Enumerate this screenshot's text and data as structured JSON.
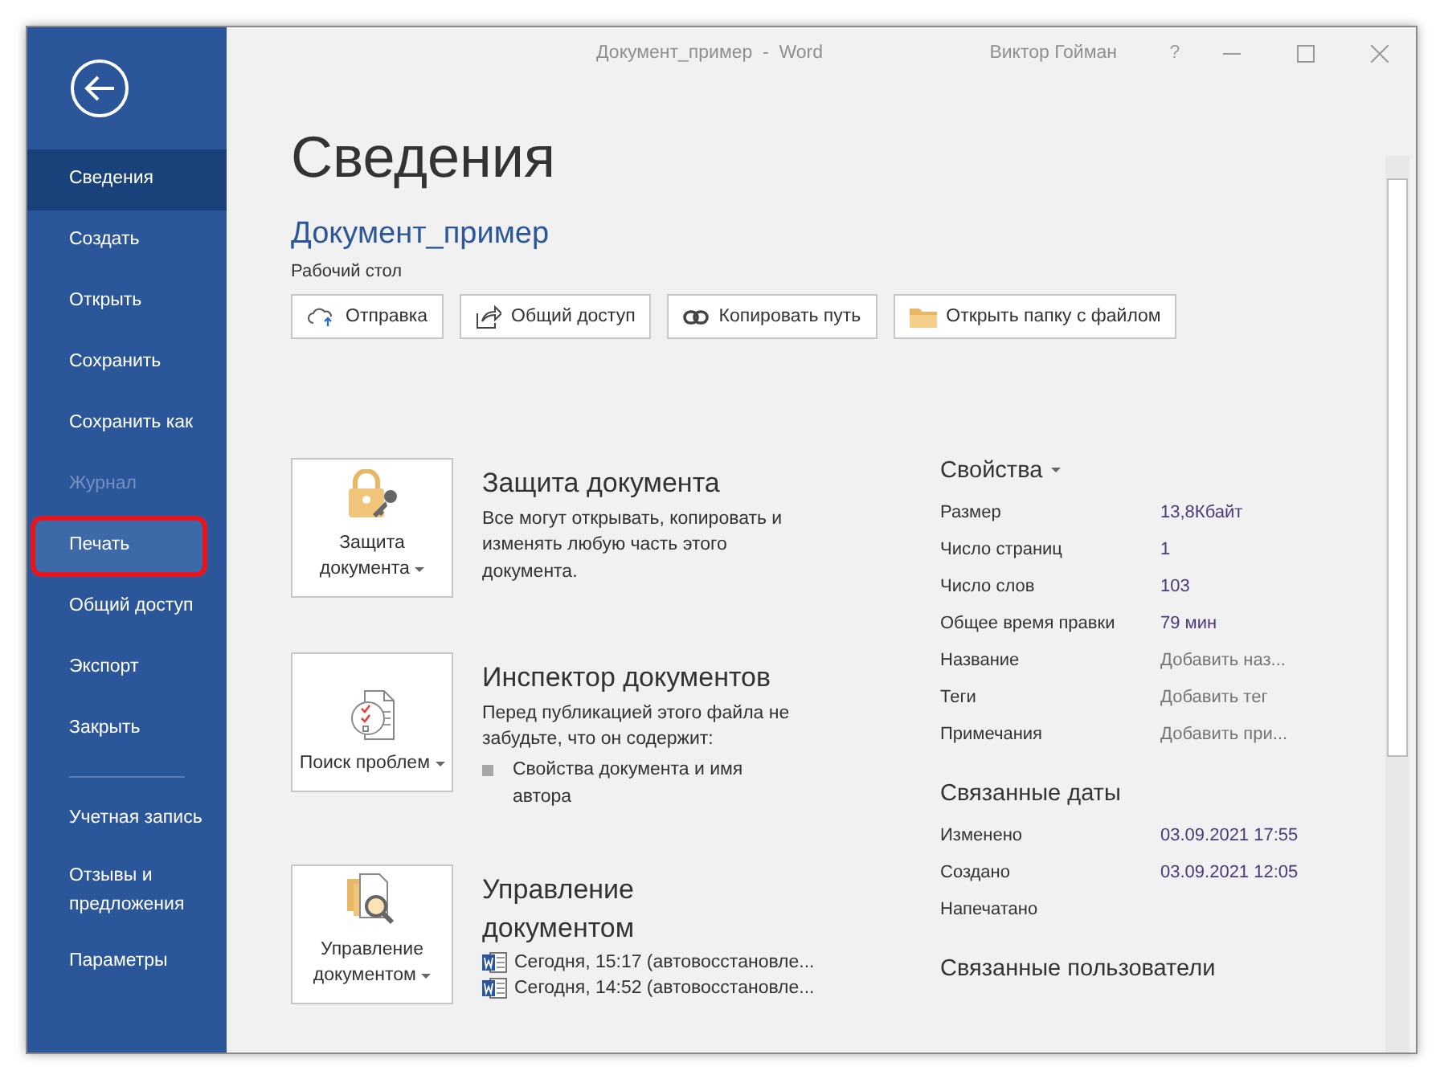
{
  "window": {
    "title": "Документ_пример  -  Word",
    "user": "Виктор Гойман",
    "help": "?"
  },
  "sidebar": {
    "items": [
      {
        "label": "Сведения",
        "selected": true,
        "disabled": false,
        "highlighted": false,
        "divider_before": false
      },
      {
        "label": "Создать",
        "selected": false,
        "disabled": false,
        "highlighted": false,
        "divider_before": false
      },
      {
        "label": "Открыть",
        "selected": false,
        "disabled": false,
        "highlighted": false,
        "divider_before": false
      },
      {
        "label": "Сохранить",
        "selected": false,
        "disabled": false,
        "highlighted": false,
        "divider_before": false
      },
      {
        "label": "Сохранить как",
        "selected": false,
        "disabled": false,
        "highlighted": false,
        "divider_before": false
      },
      {
        "label": "Журнал",
        "selected": false,
        "disabled": true,
        "highlighted": false,
        "divider_before": false
      },
      {
        "label": "Печать",
        "selected": false,
        "disabled": false,
        "highlighted": true,
        "divider_before": false
      },
      {
        "label": "Общий доступ",
        "selected": false,
        "disabled": false,
        "highlighted": false,
        "divider_before": false
      },
      {
        "label": "Экспорт",
        "selected": false,
        "disabled": false,
        "highlighted": false,
        "divider_before": false
      },
      {
        "label": "Закрыть",
        "selected": false,
        "disabled": false,
        "highlighted": false,
        "divider_before": false
      },
      {
        "label": "Учетная запись",
        "selected": false,
        "disabled": false,
        "highlighted": false,
        "divider_before": true
      },
      {
        "label": "Отзывы и предложения",
        "selected": false,
        "disabled": false,
        "highlighted": false,
        "divider_before": false
      },
      {
        "label": "Параметры",
        "selected": false,
        "disabled": false,
        "highlighted": false,
        "divider_before": false
      }
    ]
  },
  "page_title": "Сведения",
  "document": {
    "name": "Документ_пример",
    "location": "Рабочий стол"
  },
  "actions": [
    {
      "kind": "upload",
      "label": "Отправка"
    },
    {
      "kind": "share",
      "label": "Общий доступ"
    },
    {
      "kind": "link",
      "label": "Копировать путь"
    },
    {
      "kind": "folder",
      "label": "Открыть папку с файлом"
    }
  ],
  "sections": [
    {
      "kind": "protect",
      "tile": "Защита документа",
      "heading": "Защита документа",
      "text": "Все могут открывать, копировать и изменять любую часть этого документа."
    },
    {
      "kind": "inspect",
      "tile": "Поиск проблем",
      "heading": "Инспектор документов",
      "text": "Перед публикацией этого файла не забудьте, что он содержит:",
      "bullets": [
        "Свойства документа и имя автора"
      ]
    },
    {
      "kind": "manage",
      "tile": "Управление документом",
      "heading": "Управление документом",
      "versions": [
        "Сегодня, 15:17 (автовосстановле...",
        "Сегодня, 14:52 (автовосстановле..."
      ]
    }
  ],
  "properties": {
    "title": "Свойства",
    "rows": [
      {
        "label": "Размер",
        "value": "13,8Кбайт",
        "kind": "value"
      },
      {
        "label": "Число страниц",
        "value": "1",
        "kind": "value"
      },
      {
        "label": "Число слов",
        "value": "103",
        "kind": "value"
      },
      {
        "label": "Общее время правки",
        "value": "79 мин",
        "kind": "value"
      },
      {
        "label": "Название",
        "value": "Добавить наз...",
        "kind": "prompt"
      },
      {
        "label": "Теги",
        "value": "Добавить тег",
        "kind": "prompt"
      },
      {
        "label": "Примечания",
        "value": "Добавить при...",
        "kind": "prompt"
      }
    ]
  },
  "dates": {
    "title": "Связанные даты",
    "rows": [
      {
        "label": "Изменено",
        "value": "03.09.2021 17:55"
      },
      {
        "label": "Создано",
        "value": "03.09.2021 12:05"
      },
      {
        "label": "Напечатано"
      }
    ]
  },
  "people": {
    "title": "Связанные пользователи"
  }
}
